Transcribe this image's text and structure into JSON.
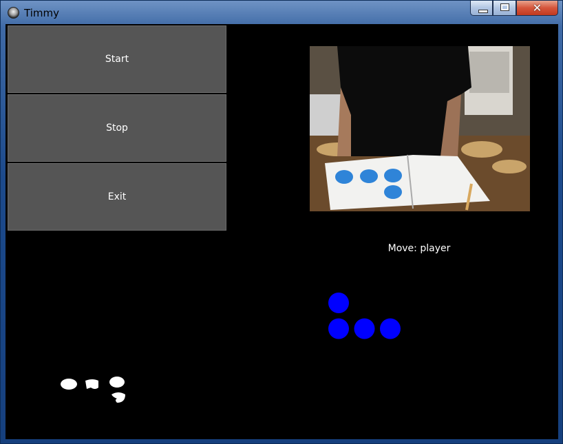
{
  "window": {
    "title": "Timmy"
  },
  "buttons": {
    "start_label": "Start",
    "stop_label": "Stop",
    "exit_label": "Exit"
  },
  "status": {
    "move_text": "Move: player"
  },
  "board_state": {
    "color": "#0000ff",
    "pieces": [
      {
        "row": 0,
        "col": 0
      },
      {
        "row": 1,
        "col": 0
      },
      {
        "row": 1,
        "col": 1
      },
      {
        "row": 1,
        "col": 2
      }
    ]
  },
  "colors": {
    "background": "#000000",
    "button_bg": "#555555",
    "piece": "#0000ff"
  }
}
